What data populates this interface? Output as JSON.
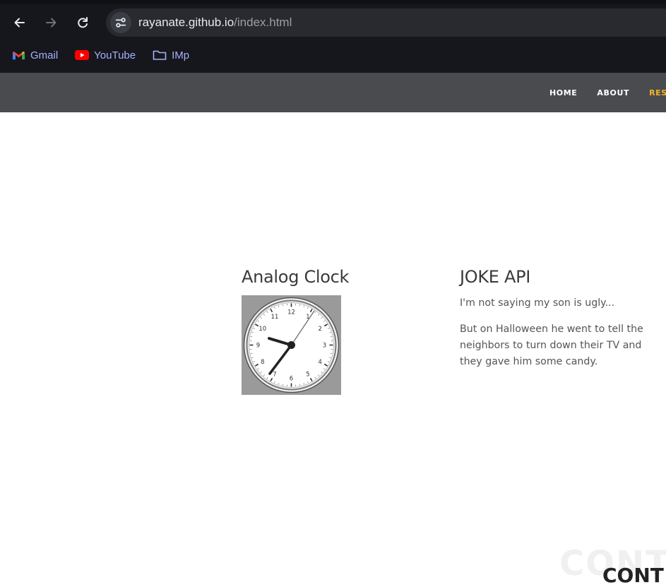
{
  "browser": {
    "url_host": "rayanate.github.io",
    "url_path": "/index.html",
    "bookmarks": [
      {
        "label": "Gmail",
        "icon": "gmail-icon"
      },
      {
        "label": "YouTube",
        "icon": "youtube-icon"
      },
      {
        "label": "IMp",
        "icon": "folder-icon"
      }
    ]
  },
  "site_nav": {
    "items": [
      {
        "label": "HOME"
      },
      {
        "label": "ABOUT"
      },
      {
        "label": "RESU"
      }
    ],
    "active_color": "#f4b328"
  },
  "clock": {
    "title": "Analog Clock",
    "numbers": [
      "12",
      "1",
      "2",
      "3",
      "4",
      "5",
      "6",
      "7",
      "8",
      "9",
      "10",
      "11"
    ]
  },
  "joke": {
    "title": "JOKE API",
    "setup": "I'm not saying my son is ugly...",
    "punchline": "But on Halloween he went to tell the neighbors to turn down their TV and they gave him some candy."
  },
  "contact": {
    "bg_text": "CONTA",
    "fg_text": "CONT"
  }
}
